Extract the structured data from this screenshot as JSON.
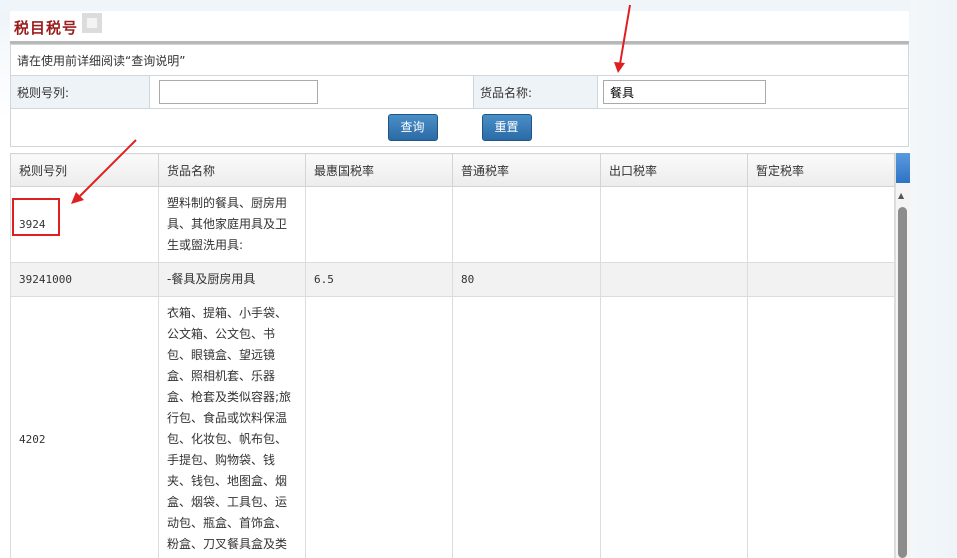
{
  "page": {
    "title": "税目税号",
    "note": "请在使用前详细阅读“查询说明”"
  },
  "form": {
    "code_label": "税则号列:",
    "code_value": "",
    "name_label": "货品名称:",
    "name_value": "餐具",
    "query_button": "查询",
    "reset_button": "重置"
  },
  "table": {
    "headers": [
      "税则号列",
      "货品名称",
      "最惠国税率",
      "普通税率",
      "出口税率",
      "暂定税率"
    ],
    "rows": [
      {
        "code": "3924",
        "name": "塑料制的餐具、厨房用具、其他家庭用具及卫生或盥洗用具:",
        "mfn": "",
        "general": "",
        "export": "",
        "provisional": ""
      },
      {
        "code": "39241000",
        "name": "-餐具及厨房用具",
        "mfn": "6.5",
        "general": "80",
        "export": "",
        "provisional": ""
      },
      {
        "code": "4202",
        "name": "衣箱、提箱、小手袋、公文箱、公文包、书包、眼镜盒、望远镜盒、照相机套、乐器盒、枪套及类似容器;旅行包、食品或饮料保温包、化妆包、帆布包、手提包、购物袋、钱夹、钱包、地图盒、烟盒、烟袋、工具包、运动包、瓶盒、首饰盒、粉盒、刀叉餐具盒及类似容器,用皮革或",
        "mfn": "",
        "general": "",
        "export": "",
        "provisional": ""
      }
    ]
  },
  "colors": {
    "title": "#9b1c1c",
    "button": "#2b6aa6",
    "annotation": "#e02020"
  },
  "icons": [
    "scroll-up-icon"
  ]
}
